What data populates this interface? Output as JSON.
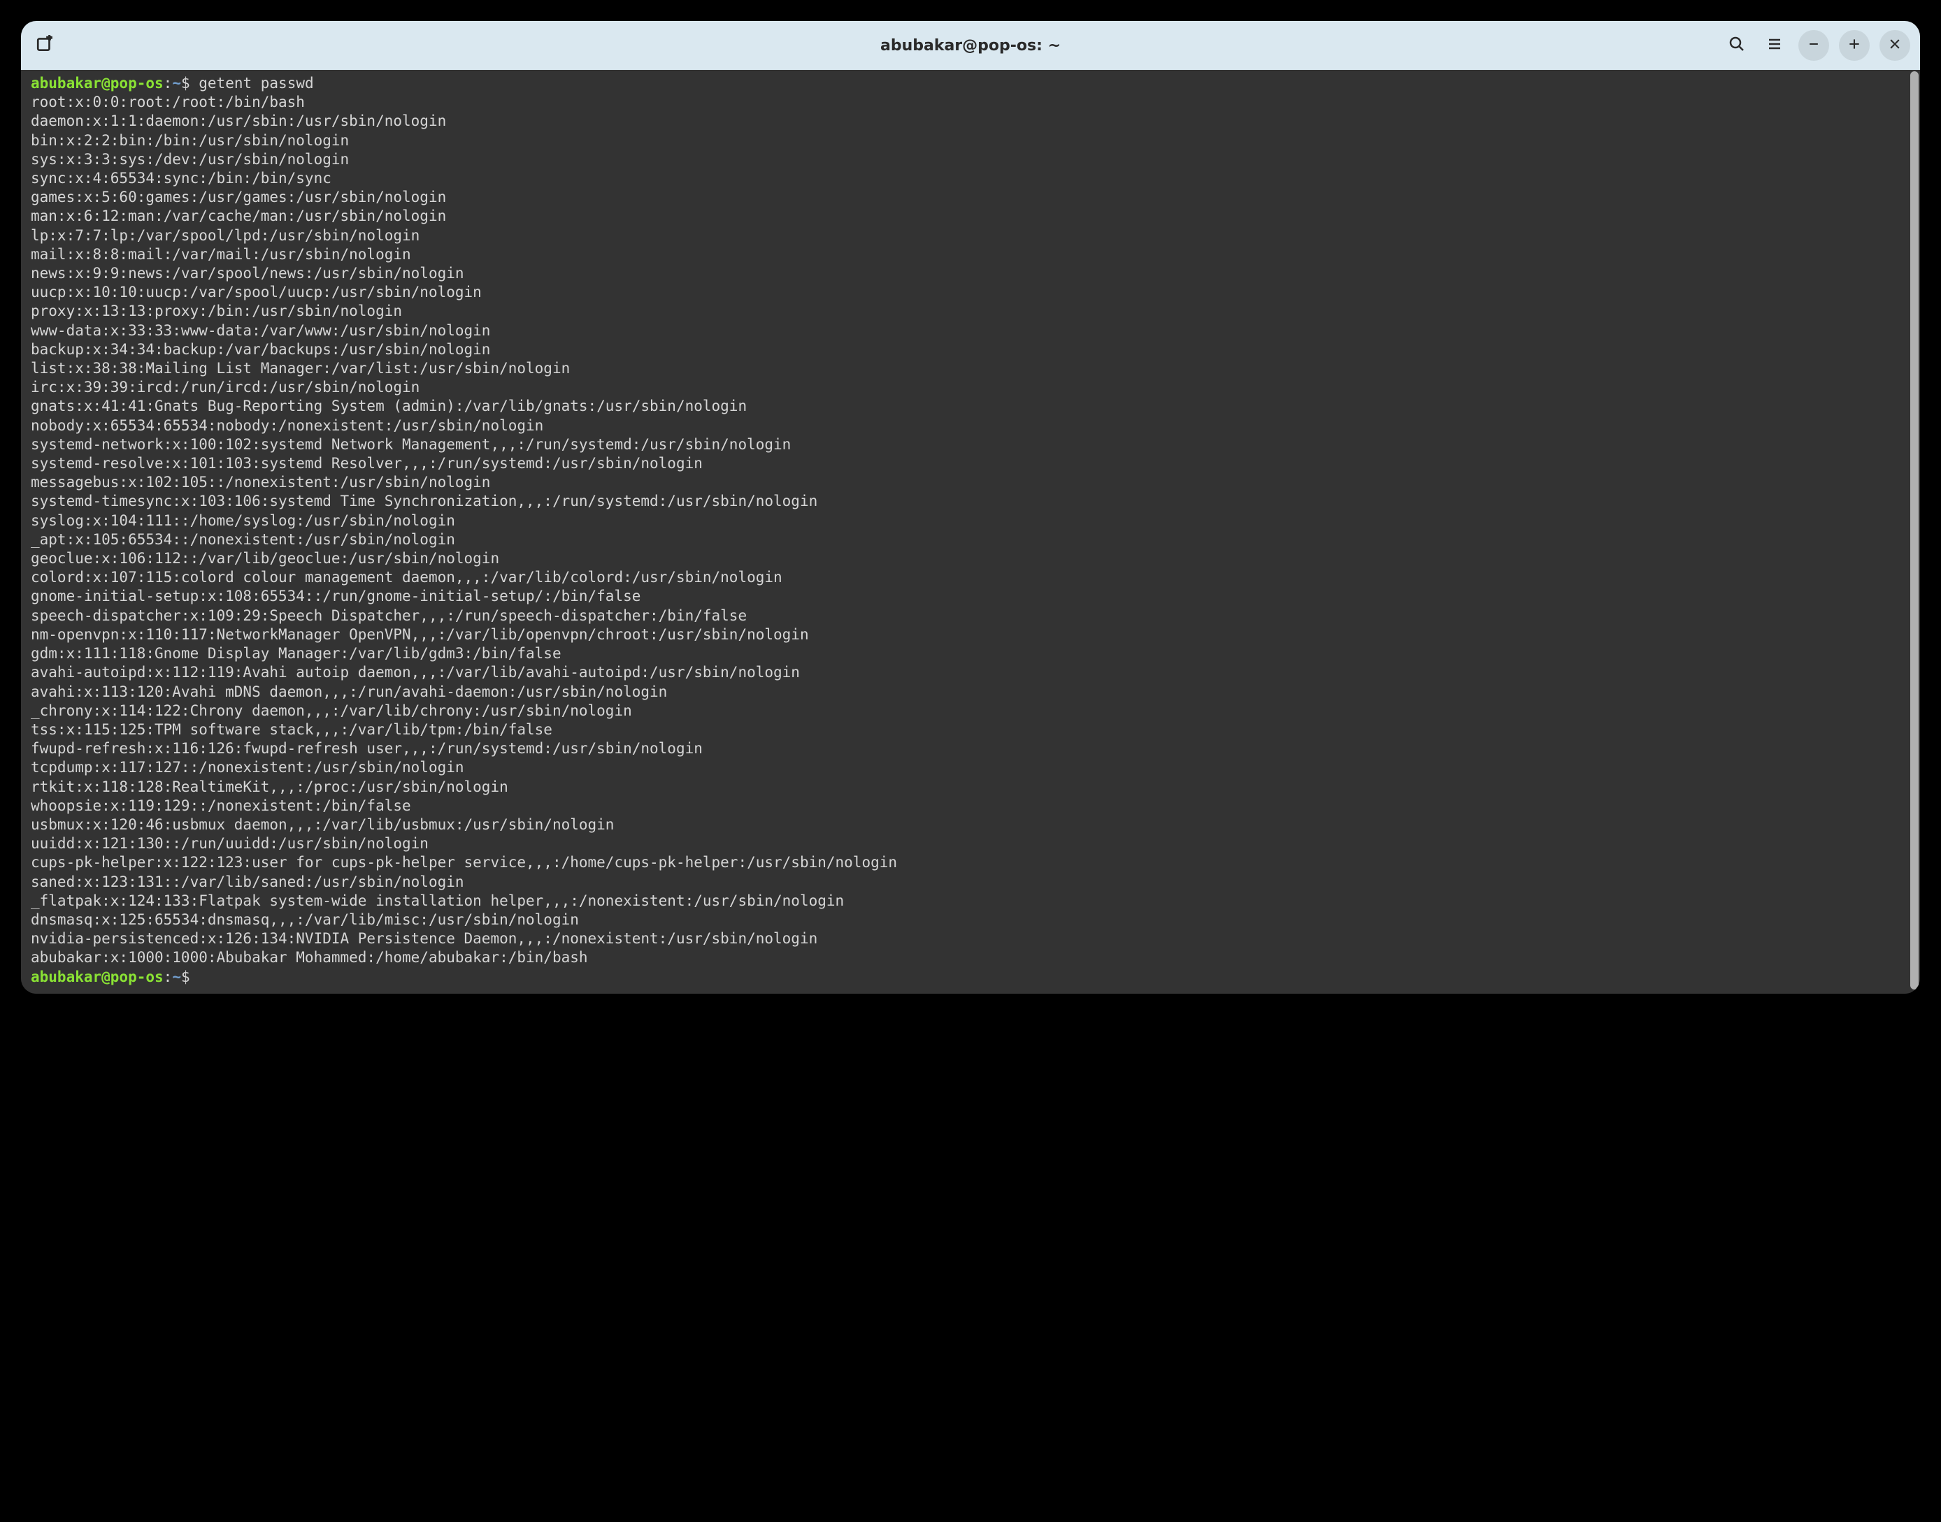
{
  "window": {
    "title": "abubakar@pop-os: ~"
  },
  "titlebar": {
    "icons": {
      "new_tab": "new-tab-icon",
      "search": "search-icon",
      "menu": "menu-icon",
      "minimize": "minimize-icon",
      "maximize": "maximize-icon",
      "close": "close-icon"
    }
  },
  "colors": {
    "titlebar_bg": "#dae8f0",
    "term_bg": "#333333",
    "term_fg": "#d5d5d5",
    "prompt_user": "#8ae234",
    "prompt_path": "#729fcf"
  },
  "terminal": {
    "prompt": {
      "user_host": "abubakar@pop-os",
      "sep1": ":",
      "path": "~",
      "sep2": "$ "
    },
    "command": "getent passwd",
    "output_lines": [
      "root:x:0:0:root:/root:/bin/bash",
      "daemon:x:1:1:daemon:/usr/sbin:/usr/sbin/nologin",
      "bin:x:2:2:bin:/bin:/usr/sbin/nologin",
      "sys:x:3:3:sys:/dev:/usr/sbin/nologin",
      "sync:x:4:65534:sync:/bin:/bin/sync",
      "games:x:5:60:games:/usr/games:/usr/sbin/nologin",
      "man:x:6:12:man:/var/cache/man:/usr/sbin/nologin",
      "lp:x:7:7:lp:/var/spool/lpd:/usr/sbin/nologin",
      "mail:x:8:8:mail:/var/mail:/usr/sbin/nologin",
      "news:x:9:9:news:/var/spool/news:/usr/sbin/nologin",
      "uucp:x:10:10:uucp:/var/spool/uucp:/usr/sbin/nologin",
      "proxy:x:13:13:proxy:/bin:/usr/sbin/nologin",
      "www-data:x:33:33:www-data:/var/www:/usr/sbin/nologin",
      "backup:x:34:34:backup:/var/backups:/usr/sbin/nologin",
      "list:x:38:38:Mailing List Manager:/var/list:/usr/sbin/nologin",
      "irc:x:39:39:ircd:/run/ircd:/usr/sbin/nologin",
      "gnats:x:41:41:Gnats Bug-Reporting System (admin):/var/lib/gnats:/usr/sbin/nologin",
      "nobody:x:65534:65534:nobody:/nonexistent:/usr/sbin/nologin",
      "systemd-network:x:100:102:systemd Network Management,,,:/run/systemd:/usr/sbin/nologin",
      "systemd-resolve:x:101:103:systemd Resolver,,,:/run/systemd:/usr/sbin/nologin",
      "messagebus:x:102:105::/nonexistent:/usr/sbin/nologin",
      "systemd-timesync:x:103:106:systemd Time Synchronization,,,:/run/systemd:/usr/sbin/nologin",
      "syslog:x:104:111::/home/syslog:/usr/sbin/nologin",
      "_apt:x:105:65534::/nonexistent:/usr/sbin/nologin",
      "geoclue:x:106:112::/var/lib/geoclue:/usr/sbin/nologin",
      "colord:x:107:115:colord colour management daemon,,,:/var/lib/colord:/usr/sbin/nologin",
      "gnome-initial-setup:x:108:65534::/run/gnome-initial-setup/:/bin/false",
      "speech-dispatcher:x:109:29:Speech Dispatcher,,,:/run/speech-dispatcher:/bin/false",
      "nm-openvpn:x:110:117:NetworkManager OpenVPN,,,:/var/lib/openvpn/chroot:/usr/sbin/nologin",
      "gdm:x:111:118:Gnome Display Manager:/var/lib/gdm3:/bin/false",
      "avahi-autoipd:x:112:119:Avahi autoip daemon,,,:/var/lib/avahi-autoipd:/usr/sbin/nologin",
      "avahi:x:113:120:Avahi mDNS daemon,,,:/run/avahi-daemon:/usr/sbin/nologin",
      "_chrony:x:114:122:Chrony daemon,,,:/var/lib/chrony:/usr/sbin/nologin",
      "tss:x:115:125:TPM software stack,,,:/var/lib/tpm:/bin/false",
      "fwupd-refresh:x:116:126:fwupd-refresh user,,,:/run/systemd:/usr/sbin/nologin",
      "tcpdump:x:117:127::/nonexistent:/usr/sbin/nologin",
      "rtkit:x:118:128:RealtimeKit,,,:/proc:/usr/sbin/nologin",
      "whoopsie:x:119:129::/nonexistent:/bin/false",
      "usbmux:x:120:46:usbmux daemon,,,:/var/lib/usbmux:/usr/sbin/nologin",
      "uuidd:x:121:130::/run/uuidd:/usr/sbin/nologin",
      "cups-pk-helper:x:122:123:user for cups-pk-helper service,,,:/home/cups-pk-helper:/usr/sbin/nologin",
      "saned:x:123:131::/var/lib/saned:/usr/sbin/nologin",
      "_flatpak:x:124:133:Flatpak system-wide installation helper,,,:/nonexistent:/usr/sbin/nologin",
      "dnsmasq:x:125:65534:dnsmasq,,,:/var/lib/misc:/usr/sbin/nologin",
      "nvidia-persistenced:x:126:134:NVIDIA Persistence Daemon,,,:/nonexistent:/usr/sbin/nologin",
      "abubakar:x:1000:1000:Abubakar Mohammed:/home/abubakar:/bin/bash"
    ],
    "cursor": " "
  }
}
